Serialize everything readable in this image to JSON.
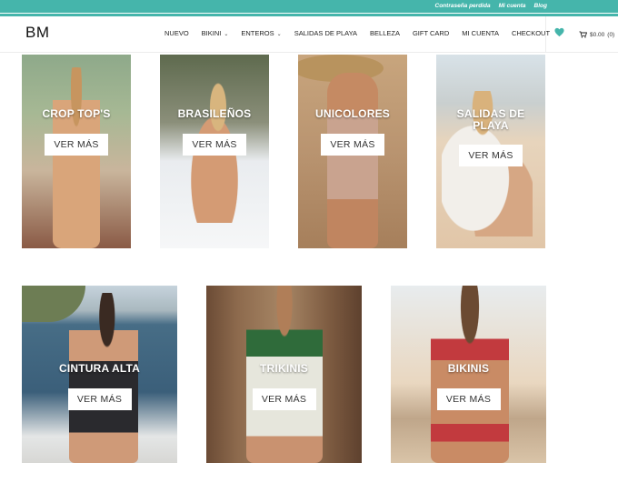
{
  "topbar": {
    "links": [
      "Contraseña perdida",
      "Mi cuenta",
      "Blog"
    ]
  },
  "header": {
    "logo": "BM",
    "nav": [
      {
        "label": "NUEVO",
        "has_dropdown": false
      },
      {
        "label": "BIKINI",
        "has_dropdown": true
      },
      {
        "label": "ENTEROS",
        "has_dropdown": true
      },
      {
        "label": "SALIDAS DE PLAYA",
        "has_dropdown": false
      },
      {
        "label": "BELLEZA",
        "has_dropdown": false
      },
      {
        "label": "GIFT CARD",
        "has_dropdown": false
      },
      {
        "label": "MI CUENTA",
        "has_dropdown": false
      },
      {
        "label": "CHECKOUT",
        "has_dropdown": false
      }
    ],
    "wishlist_icon": "heart-icon",
    "cart": {
      "icon": "cart-icon",
      "total": "$0.00",
      "count": "(0)"
    }
  },
  "categories": [
    {
      "title": "CROP TOP'S",
      "button": "VER MÁS"
    },
    {
      "title": "BRASILEÑOS",
      "button": "VER MÁS"
    },
    {
      "title": "UNICOLORES",
      "button": "VER MÁS"
    },
    {
      "title": "SALIDAS DE\nPLAYA",
      "button": "VER MÁS"
    },
    {
      "title": "CINTURA ALTA",
      "button": "VER MÁS"
    },
    {
      "title": "TRIKINIS",
      "button": "VER MÁS"
    },
    {
      "title": "BIKINIS",
      "button": "VER MÁS"
    }
  ],
  "colors": {
    "accent": "#45b5ab",
    "button_bg": "#ffffff",
    "text": "#222222"
  }
}
